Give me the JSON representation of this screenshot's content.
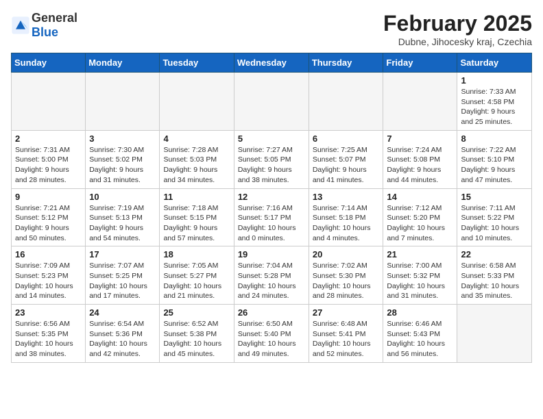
{
  "header": {
    "logo_general": "General",
    "logo_blue": "Blue",
    "month_title": "February 2025",
    "subtitle": "Dubne, Jihocesky kraj, Czechia"
  },
  "weekdays": [
    "Sunday",
    "Monday",
    "Tuesday",
    "Wednesday",
    "Thursday",
    "Friday",
    "Saturday"
  ],
  "weeks": [
    [
      {
        "day": "",
        "info": ""
      },
      {
        "day": "",
        "info": ""
      },
      {
        "day": "",
        "info": ""
      },
      {
        "day": "",
        "info": ""
      },
      {
        "day": "",
        "info": ""
      },
      {
        "day": "",
        "info": ""
      },
      {
        "day": "1",
        "info": "Sunrise: 7:33 AM\nSunset: 4:58 PM\nDaylight: 9 hours and 25 minutes."
      }
    ],
    [
      {
        "day": "2",
        "info": "Sunrise: 7:31 AM\nSunset: 5:00 PM\nDaylight: 9 hours and 28 minutes."
      },
      {
        "day": "3",
        "info": "Sunrise: 7:30 AM\nSunset: 5:02 PM\nDaylight: 9 hours and 31 minutes."
      },
      {
        "day": "4",
        "info": "Sunrise: 7:28 AM\nSunset: 5:03 PM\nDaylight: 9 hours and 34 minutes."
      },
      {
        "day": "5",
        "info": "Sunrise: 7:27 AM\nSunset: 5:05 PM\nDaylight: 9 hours and 38 minutes."
      },
      {
        "day": "6",
        "info": "Sunrise: 7:25 AM\nSunset: 5:07 PM\nDaylight: 9 hours and 41 minutes."
      },
      {
        "day": "7",
        "info": "Sunrise: 7:24 AM\nSunset: 5:08 PM\nDaylight: 9 hours and 44 minutes."
      },
      {
        "day": "8",
        "info": "Sunrise: 7:22 AM\nSunset: 5:10 PM\nDaylight: 9 hours and 47 minutes."
      }
    ],
    [
      {
        "day": "9",
        "info": "Sunrise: 7:21 AM\nSunset: 5:12 PM\nDaylight: 9 hours and 50 minutes."
      },
      {
        "day": "10",
        "info": "Sunrise: 7:19 AM\nSunset: 5:13 PM\nDaylight: 9 hours and 54 minutes."
      },
      {
        "day": "11",
        "info": "Sunrise: 7:18 AM\nSunset: 5:15 PM\nDaylight: 9 hours and 57 minutes."
      },
      {
        "day": "12",
        "info": "Sunrise: 7:16 AM\nSunset: 5:17 PM\nDaylight: 10 hours and 0 minutes."
      },
      {
        "day": "13",
        "info": "Sunrise: 7:14 AM\nSunset: 5:18 PM\nDaylight: 10 hours and 4 minutes."
      },
      {
        "day": "14",
        "info": "Sunrise: 7:12 AM\nSunset: 5:20 PM\nDaylight: 10 hours and 7 minutes."
      },
      {
        "day": "15",
        "info": "Sunrise: 7:11 AM\nSunset: 5:22 PM\nDaylight: 10 hours and 10 minutes."
      }
    ],
    [
      {
        "day": "16",
        "info": "Sunrise: 7:09 AM\nSunset: 5:23 PM\nDaylight: 10 hours and 14 minutes."
      },
      {
        "day": "17",
        "info": "Sunrise: 7:07 AM\nSunset: 5:25 PM\nDaylight: 10 hours and 17 minutes."
      },
      {
        "day": "18",
        "info": "Sunrise: 7:05 AM\nSunset: 5:27 PM\nDaylight: 10 hours and 21 minutes."
      },
      {
        "day": "19",
        "info": "Sunrise: 7:04 AM\nSunset: 5:28 PM\nDaylight: 10 hours and 24 minutes."
      },
      {
        "day": "20",
        "info": "Sunrise: 7:02 AM\nSunset: 5:30 PM\nDaylight: 10 hours and 28 minutes."
      },
      {
        "day": "21",
        "info": "Sunrise: 7:00 AM\nSunset: 5:32 PM\nDaylight: 10 hours and 31 minutes."
      },
      {
        "day": "22",
        "info": "Sunrise: 6:58 AM\nSunset: 5:33 PM\nDaylight: 10 hours and 35 minutes."
      }
    ],
    [
      {
        "day": "23",
        "info": "Sunrise: 6:56 AM\nSunset: 5:35 PM\nDaylight: 10 hours and 38 minutes."
      },
      {
        "day": "24",
        "info": "Sunrise: 6:54 AM\nSunset: 5:36 PM\nDaylight: 10 hours and 42 minutes."
      },
      {
        "day": "25",
        "info": "Sunrise: 6:52 AM\nSunset: 5:38 PM\nDaylight: 10 hours and 45 minutes."
      },
      {
        "day": "26",
        "info": "Sunrise: 6:50 AM\nSunset: 5:40 PM\nDaylight: 10 hours and 49 minutes."
      },
      {
        "day": "27",
        "info": "Sunrise: 6:48 AM\nSunset: 5:41 PM\nDaylight: 10 hours and 52 minutes."
      },
      {
        "day": "28",
        "info": "Sunrise: 6:46 AM\nSunset: 5:43 PM\nDaylight: 10 hours and 56 minutes."
      },
      {
        "day": "",
        "info": ""
      }
    ]
  ]
}
